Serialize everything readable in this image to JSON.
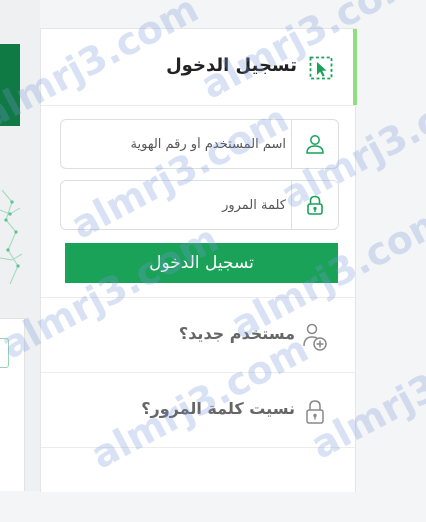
{
  "header": {
    "title": "تسجيل الدخول",
    "icon": "login-cursor-icon"
  },
  "form": {
    "username": {
      "placeholder": "اسم المستخدم أو رقم الهوية",
      "value": "",
      "icon": "user-icon"
    },
    "password": {
      "placeholder": "كلمة المرور",
      "value": "",
      "icon": "lock-icon"
    },
    "submit_label": "تسجيل الدخول"
  },
  "links": [
    {
      "label": "مستخدم جديد؟",
      "icon": "add-user-icon"
    },
    {
      "label": "نسيت كلمة المرور؟",
      "icon": "unlock-icon"
    }
  ],
  "watermark": {
    "text": "almrj3.com"
  },
  "colors": {
    "primary": "#1aa259",
    "dark_green": "#0f7a43",
    "accent": "#8ee07e"
  }
}
